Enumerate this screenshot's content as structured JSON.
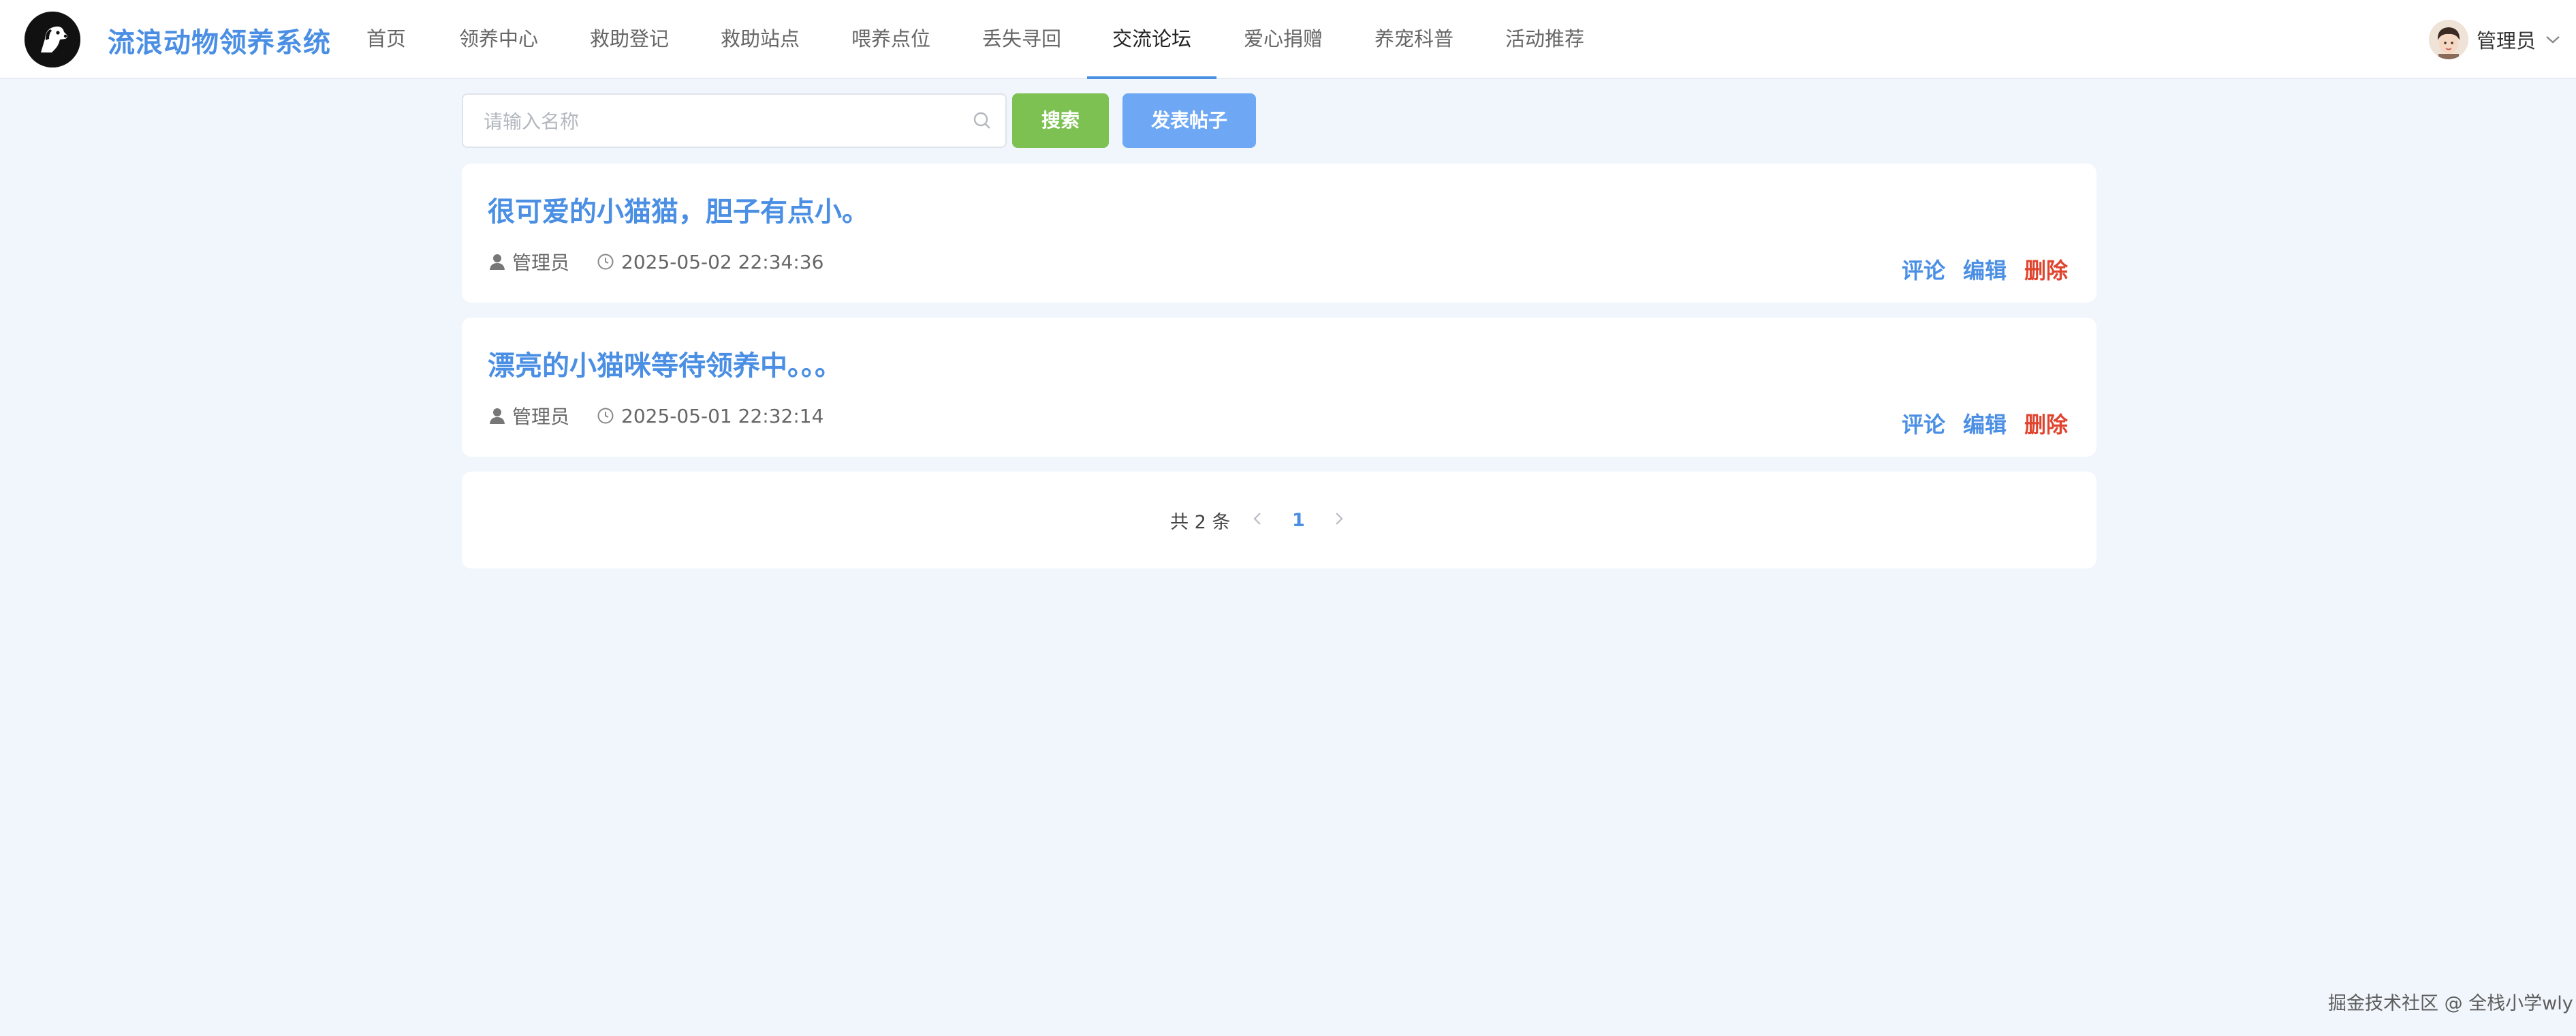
{
  "header": {
    "app_title": "流浪动物领养系统",
    "nav": [
      {
        "label": "首页"
      },
      {
        "label": "领养中心"
      },
      {
        "label": "救助登记"
      },
      {
        "label": "救助站点"
      },
      {
        "label": "喂养点位"
      },
      {
        "label": "丢失寻回"
      },
      {
        "label": "交流论坛",
        "active": true
      },
      {
        "label": "爱心捐赠"
      },
      {
        "label": "养宠科普"
      },
      {
        "label": "活动推荐"
      }
    ],
    "user_name": "管理员"
  },
  "toolbar": {
    "search_placeholder": "请输入名称",
    "search_value": "",
    "search_button": "搜索",
    "post_button": "发表帖子"
  },
  "posts": [
    {
      "title": "很可爱的小猫猫，胆子有点小。",
      "author": "管理员",
      "time": "2025-05-02 22:34:36",
      "comment": "评论",
      "edit": "编辑",
      "delete": "删除"
    },
    {
      "title": "漂亮的小猫咪等待领养中。。。",
      "author": "管理员",
      "time": "2025-05-01 22:32:14",
      "comment": "评论",
      "edit": "编辑",
      "delete": "删除"
    }
  ],
  "pagination": {
    "total_text": "共 2 条",
    "current_page": "1"
  },
  "watermark": "掘金技术社区 @ 全栈小学wly",
  "colors": {
    "accent": "#4a8fe4",
    "search_button": "#7cc152",
    "post_button": "#6ea8f4",
    "delete": "#e1442e",
    "page_bg": "#f1f6fc"
  }
}
